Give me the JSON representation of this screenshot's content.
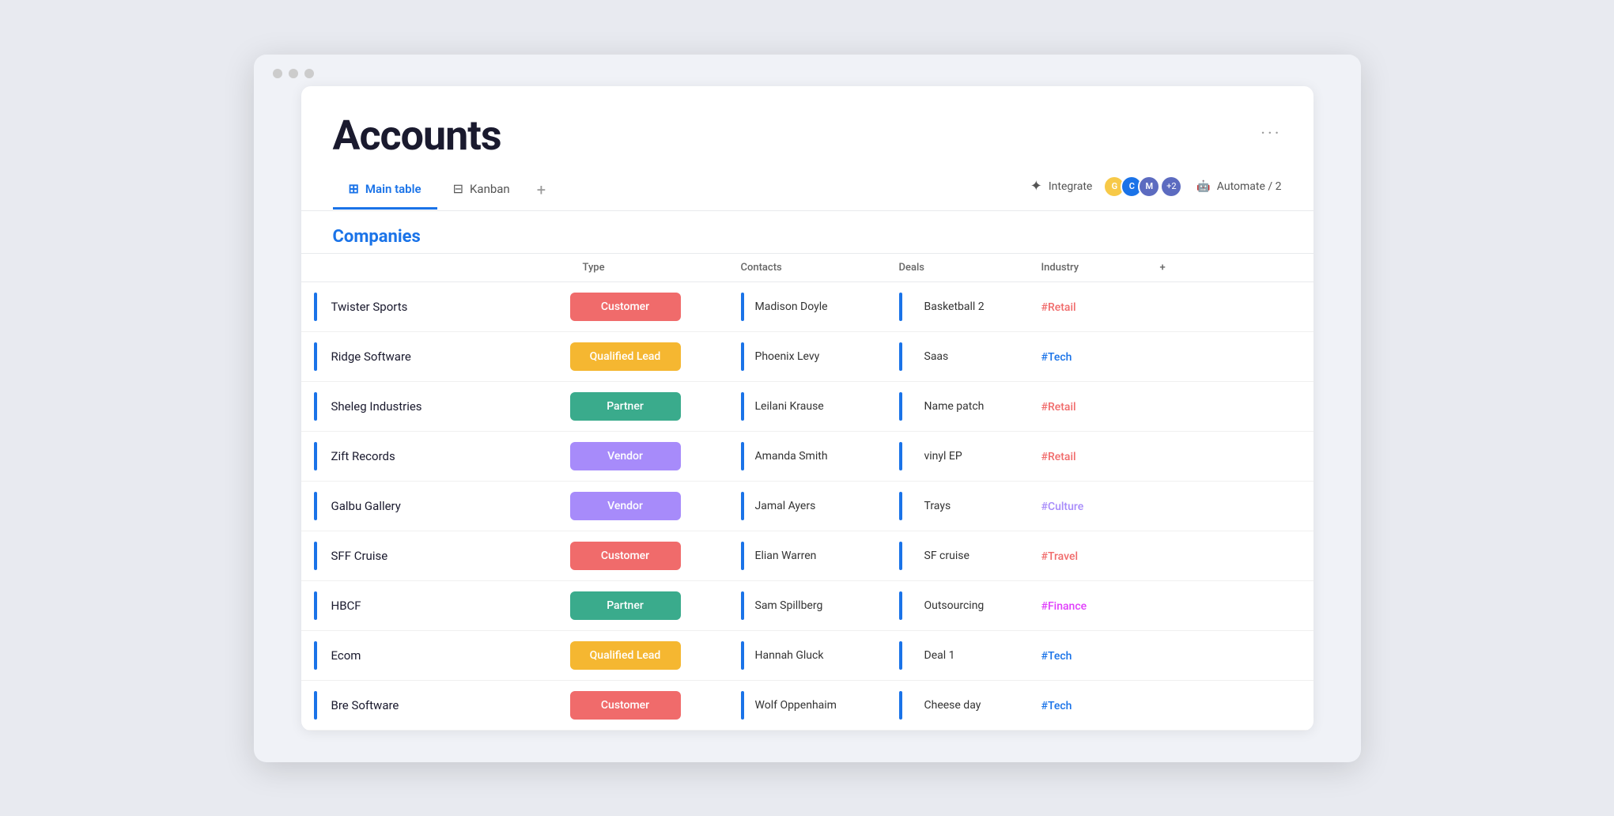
{
  "browser": {
    "dots": [
      "dot1",
      "dot2",
      "dot3"
    ]
  },
  "page": {
    "title": "Accounts",
    "more_menu": "···"
  },
  "tabs": {
    "items": [
      {
        "id": "main-table",
        "label": "Main table",
        "active": true,
        "icon": "⊞"
      },
      {
        "id": "kanban",
        "label": "Kanban",
        "active": false,
        "icon": "⊟"
      }
    ],
    "add_label": "+",
    "integrate_label": "Integrate",
    "automate_label": "Automate / 2",
    "avatar_badge": "+2"
  },
  "table": {
    "section_title": "Companies",
    "columns": {
      "company": "Companies",
      "type": "Type",
      "contacts": "Contacts",
      "deals": "Deals",
      "industry": "Industry"
    },
    "rows": [
      {
        "company": "Twister Sports",
        "type": "Customer",
        "type_class": "type-customer",
        "contact": "Madison Doyle",
        "deal": "Basketball 2",
        "industry": "#Retail",
        "industry_class": "industry-retail"
      },
      {
        "company": "Ridge Software",
        "type": "Qualified Lead",
        "type_class": "type-qualified-lead",
        "contact": "Phoenix Levy",
        "deal": "Saas",
        "industry": "#Tech",
        "industry_class": "industry-tech"
      },
      {
        "company": "Sheleg Industries",
        "type": "Partner",
        "type_class": "type-partner",
        "contact": "Leilani Krause",
        "deal": "Name patch",
        "industry": "#Retail",
        "industry_class": "industry-retail"
      },
      {
        "company": "Zift Records",
        "type": "Vendor",
        "type_class": "type-vendor",
        "contact": "Amanda Smith",
        "deal": "vinyl EP",
        "industry": "#Retail",
        "industry_class": "industry-retail"
      },
      {
        "company": "Galbu Gallery",
        "type": "Vendor",
        "type_class": "type-vendor",
        "contact": "Jamal Ayers",
        "deal": "Trays",
        "industry": "#Culture",
        "industry_class": "industry-culture"
      },
      {
        "company": "SFF Cruise",
        "type": "Customer",
        "type_class": "type-customer",
        "contact": "Elian Warren",
        "deal": "SF cruise",
        "industry": "#Travel",
        "industry_class": "industry-travel"
      },
      {
        "company": "HBCF",
        "type": "Partner",
        "type_class": "type-partner",
        "contact": "Sam Spillberg",
        "deal": "Outsourcing",
        "industry": "#Finance",
        "industry_class": "industry-finance"
      },
      {
        "company": "Ecom",
        "type": "Qualified Lead",
        "type_class": "type-qualified-lead",
        "contact": "Hannah Gluck",
        "deal": "Deal 1",
        "industry": "#Tech",
        "industry_class": "industry-tech"
      },
      {
        "company": "Bre Software",
        "type": "Customer",
        "type_class": "type-customer",
        "contact": "Wolf Oppenhaim",
        "deal": "Cheese day",
        "industry": "#Tech",
        "industry_class": "industry-tech"
      }
    ]
  }
}
